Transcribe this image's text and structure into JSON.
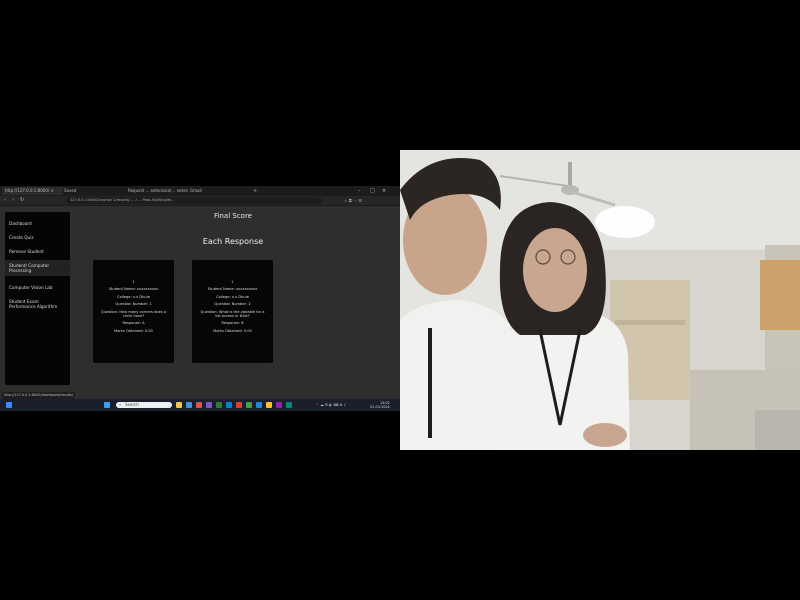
{
  "browser": {
    "tabs": [
      {
        "label": "http://127.0.0.1:8000/ ×"
      },
      {
        "label": "Saved"
      },
      {
        "label": "Request ... extension(... extension"
      },
      {
        "label": "Gmail"
      }
    ],
    "url": "127.0.0.1:8000/course/ 1/results/ ... / ... Pass-Fail/Single/..."
  },
  "sidebar": {
    "items": [
      {
        "label": "Dashboard"
      },
      {
        "label": "Create Quiz"
      },
      {
        "label": "Remove Student"
      },
      {
        "label": "Student/ Computer Processing"
      },
      {
        "label": "Computer Vision Lab"
      },
      {
        "label": "Student Exam Performance Algorithm"
      }
    ]
  },
  "main": {
    "title": "Final Score",
    "section_title": "Each Response",
    "cards": [
      {
        "number": "1",
        "student": "Student Name: xxxxxxxxxx",
        "college": "College: x.x Dhule",
        "question_no": "Question Number: 1",
        "question": "Question: How many corners does a circle have?",
        "response": "Response: A",
        "marks": "Marks Obtained: 0.00"
      },
      {
        "number": "1",
        "student": "Student Name: xxxxxxxxxx",
        "college": "College: x.x Dhule",
        "question_no": "Question Number: 2",
        "question": "Question: What is the variable for a list access in #list?",
        "response": "Response: B",
        "marks": "Marks Obtained: 0.00"
      }
    ]
  },
  "status_url": "http://127.0.0.1:8000/dashboard/results/",
  "taskbar": {
    "search_placeholder": "Search",
    "clock_time": "13:02",
    "clock_date": "01-03-2024"
  },
  "colors": {
    "page_bg": "#2e2e2e",
    "card_bg": "#060606",
    "taskbar_bg": "#1a1f2b"
  }
}
